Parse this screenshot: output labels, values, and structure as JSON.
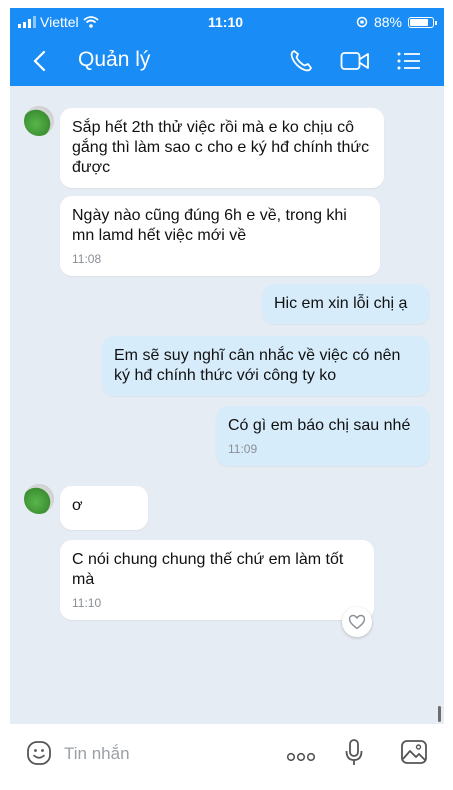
{
  "status_bar": {
    "carrier": "Viettel",
    "time": "11:10",
    "battery": "88%"
  },
  "header": {
    "title": "Quản lý",
    "icons": [
      "back-icon",
      "phone-icon",
      "video-icon",
      "menu-list-icon"
    ]
  },
  "messages": [
    {
      "sender": "other",
      "text": "Sắp hết 2th thử việc rồi mà e ko chịu cô gắng thì làm sao c cho e ký hđ chính thức được",
      "time": ""
    },
    {
      "sender": "other",
      "text": "Ngày nào cũng đúng 6h e về, trong khi mn lamd hết việc mới về",
      "time": "11:08"
    },
    {
      "sender": "me",
      "text": "Hic em xin lỗi chị ạ",
      "time": ""
    },
    {
      "sender": "me",
      "text": "Em sẽ suy nghĩ cân nhắc về việc có nên ký hđ chính thức với công ty ko",
      "time": ""
    },
    {
      "sender": "me",
      "text": "Có gì em báo chị sau nhé",
      "time": "11:09"
    },
    {
      "sender": "other",
      "text": "ơ",
      "time": ""
    },
    {
      "sender": "other",
      "text": "C nói chung chung thế chứ em làm tốt mà",
      "time": "11:10"
    }
  ],
  "input": {
    "placeholder": "Tin nhắn"
  },
  "colors": {
    "accent": "#1a8cf5",
    "chat_background": "#e6ecf3",
    "my_bubble": "#d7ecfb"
  }
}
